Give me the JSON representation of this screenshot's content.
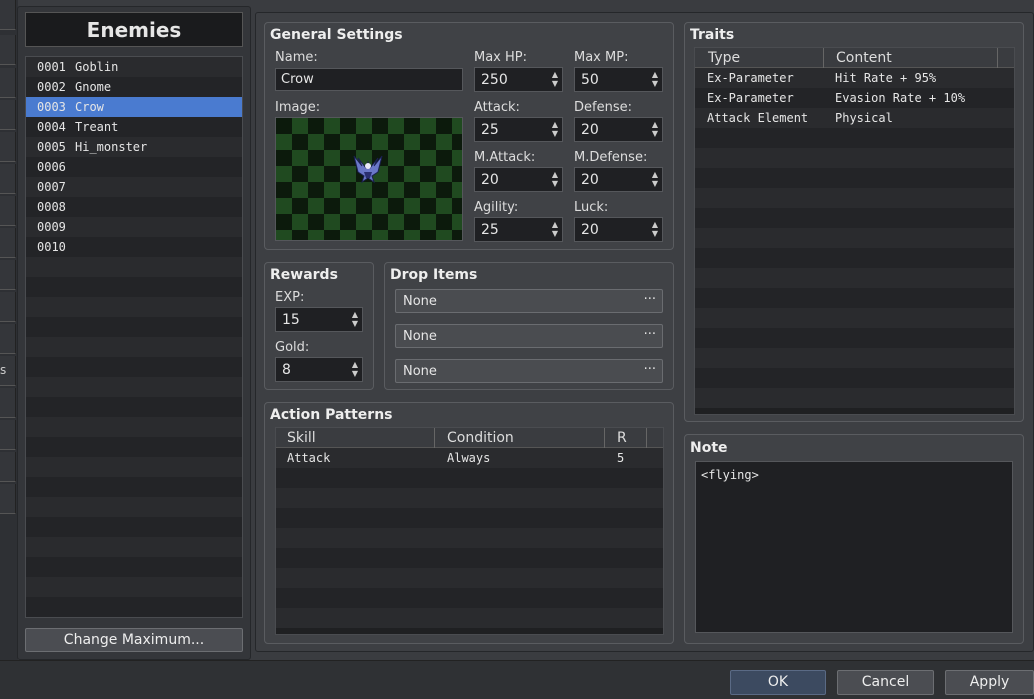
{
  "database": {
    "title": "Enemies",
    "list": [
      {
        "id": "0001",
        "name": "Goblin"
      },
      {
        "id": "0002",
        "name": "Gnome"
      },
      {
        "id": "0003",
        "name": "Crow"
      },
      {
        "id": "0004",
        "name": "Treant"
      },
      {
        "id": "0005",
        "name": "Hi_monster"
      },
      {
        "id": "0006",
        "name": ""
      },
      {
        "id": "0007",
        "name": ""
      },
      {
        "id": "0008",
        "name": ""
      },
      {
        "id": "0009",
        "name": ""
      },
      {
        "id": "0010",
        "name": ""
      }
    ],
    "selected_id": "0003",
    "change_max_label": "Change Maximum...",
    "edge_glyph": "s"
  },
  "general": {
    "title": "General Settings",
    "name_label": "Name:",
    "name_value": "Crow",
    "image_label": "Image:",
    "image_icon": "crow-sprite",
    "stats": {
      "maxhp": {
        "label": "Max HP:",
        "value": "250"
      },
      "maxmp": {
        "label": "Max MP:",
        "value": "50"
      },
      "attack": {
        "label": "Attack:",
        "value": "25"
      },
      "defense": {
        "label": "Defense:",
        "value": "20"
      },
      "mattack": {
        "label": "M.Attack:",
        "value": "20"
      },
      "mdefense": {
        "label": "M.Defense:",
        "value": "20"
      },
      "agility": {
        "label": "Agility:",
        "value": "25"
      },
      "luck": {
        "label": "Luck:",
        "value": "20"
      }
    }
  },
  "rewards": {
    "title": "Rewards",
    "exp_label": "EXP:",
    "exp_value": "15",
    "gold_label": "Gold:",
    "gold_value": "8"
  },
  "drop_items": {
    "title": "Drop Items",
    "items": [
      "None",
      "None",
      "None"
    ],
    "dots": "···"
  },
  "action_patterns": {
    "title": "Action Patterns",
    "headers": [
      "Skill",
      "Condition",
      "R"
    ],
    "rows": [
      {
        "skill": "Attack",
        "condition": "Always",
        "r": "5"
      }
    ]
  },
  "traits": {
    "title": "Traits",
    "headers": [
      "Type",
      "Content"
    ],
    "rows": [
      {
        "type": "Ex-Parameter",
        "content": "Hit Rate + 95%"
      },
      {
        "type": "Ex-Parameter",
        "content": "Evasion Rate + 10%"
      },
      {
        "type": "Attack Element",
        "content": "Physical"
      }
    ]
  },
  "note": {
    "title": "Note",
    "value": "<flying>"
  },
  "footer": {
    "ok": "OK",
    "cancel": "Cancel",
    "apply": "Apply"
  },
  "colors": {
    "selection": "#4a7bd0",
    "checker_dark": "#0c1a0c",
    "checker_light": "#204a20"
  }
}
